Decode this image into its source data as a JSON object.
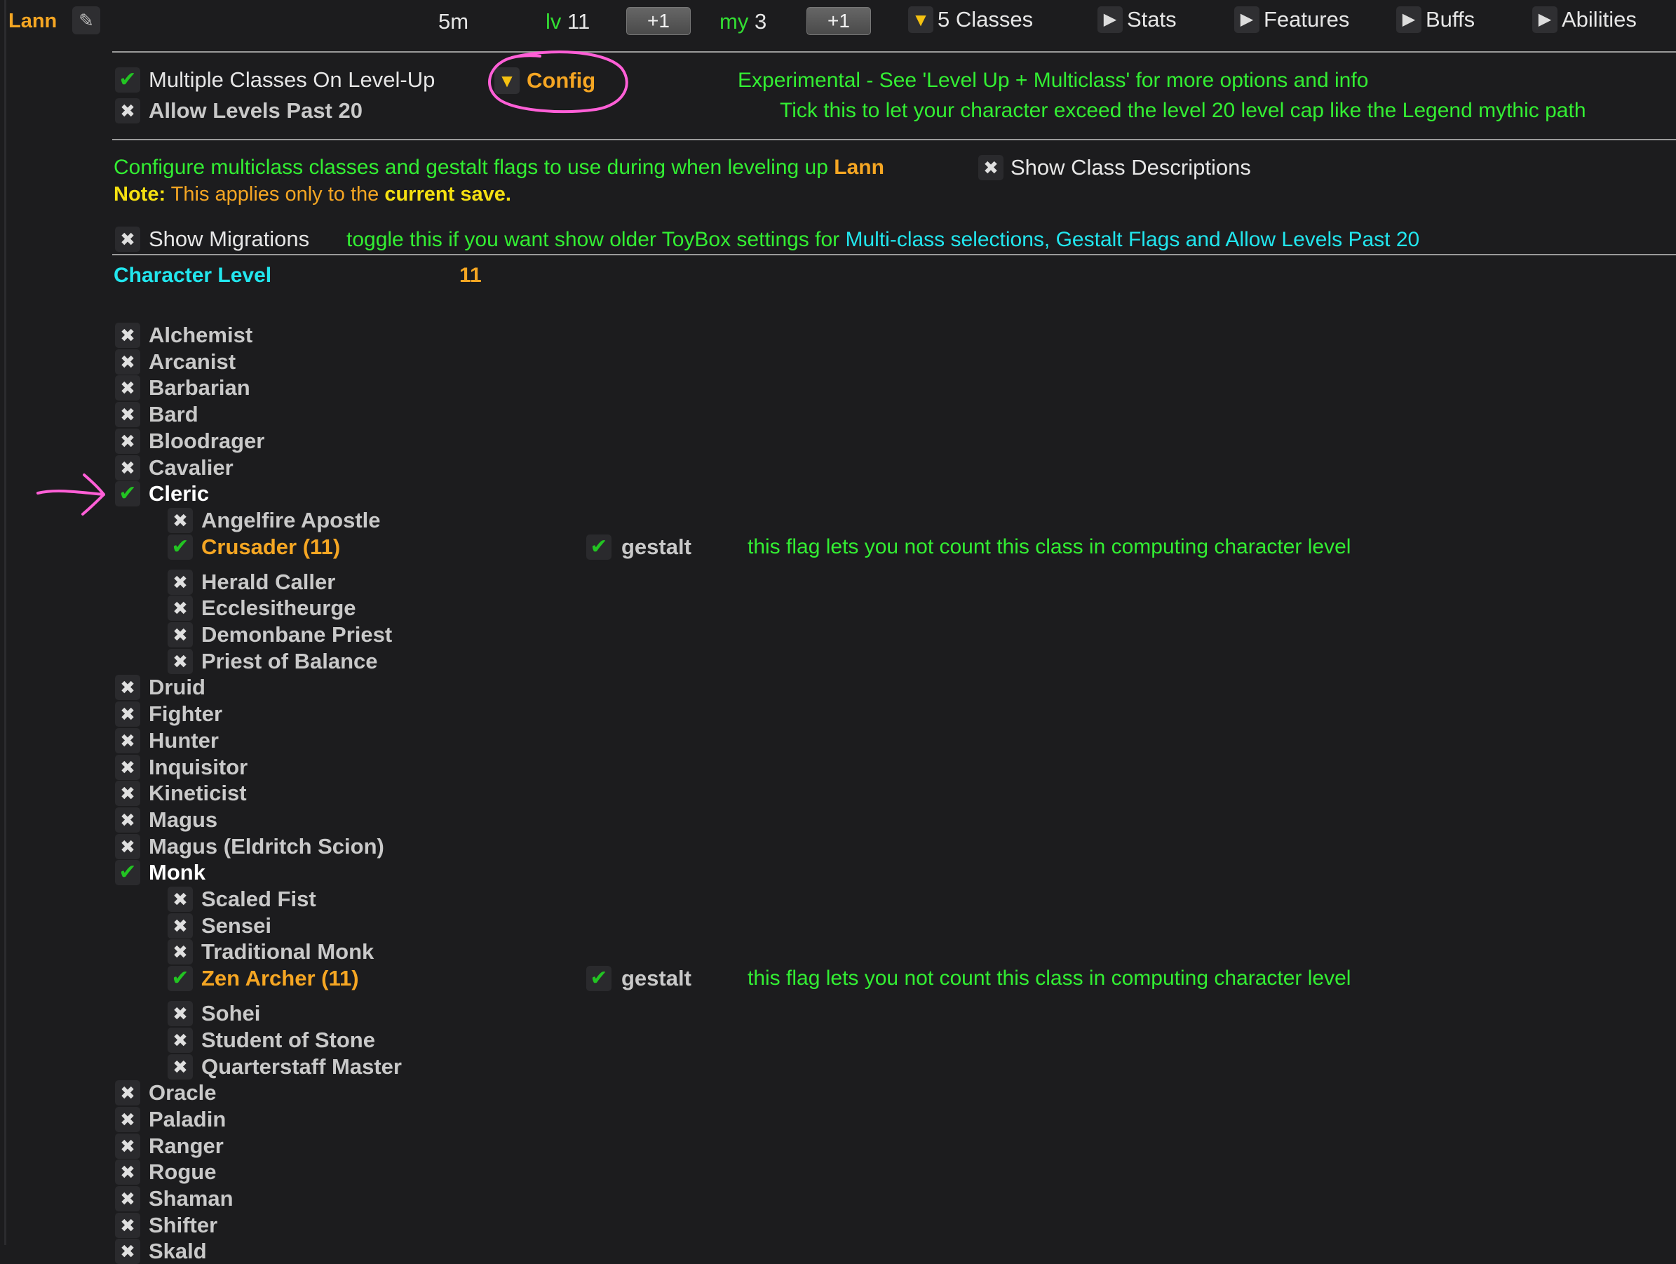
{
  "header": {
    "character_name": "Lann",
    "edit_icon": "pencil-icon",
    "time": "5m",
    "level_label": "lv",
    "level_value": "11",
    "level_plus": "+1",
    "mythic_label": "my",
    "mythic_value": "3",
    "mythic_plus": "+1",
    "nav": [
      {
        "label": "5 Classes",
        "expanded": true
      },
      {
        "label": "Stats",
        "expanded": false
      },
      {
        "label": "Features",
        "expanded": false
      },
      {
        "label": "Buffs",
        "expanded": false
      },
      {
        "label": "Abilities",
        "expanded": false
      }
    ]
  },
  "options": {
    "multiclass_label": "Multiple Classes On Level-Up",
    "multiclass_checked": true,
    "config_label": "Config",
    "multiclass_hint": "Experimental - See 'Level Up + Multiclass' for more options and info",
    "past20_label": "Allow Levels Past 20",
    "past20_checked": false,
    "past20_hint": "Tick this to let your character exceed the level 20 level cap like the Legend mythic path"
  },
  "config": {
    "desc_prefix": "Configure multiclass classes and gestalt flags to use during when leveling up",
    "desc_name": "Lann",
    "show_desc_label": "Show Class Descriptions",
    "note_label": "Note:",
    "note_text": "This applies only to the",
    "note_emphasis": "current save.",
    "migrations_label": "Show Migrations",
    "migrations_hint_prefix": "toggle this if you want show older ToyBox settings for",
    "migrations_hint_link": "Multi-class selections, Gestalt Flags and Allow Levels Past 20",
    "char_level_label": "Character Level",
    "char_level_value": "11"
  },
  "gestalt": {
    "label": "gestalt",
    "hint": "this flag lets you not count this class in computing character level"
  },
  "classes": [
    {
      "name": "Alchemist",
      "checked": false
    },
    {
      "name": "Arcanist",
      "checked": false
    },
    {
      "name": "Barbarian",
      "checked": false
    },
    {
      "name": "Bard",
      "checked": false
    },
    {
      "name": "Bloodrager",
      "checked": false
    },
    {
      "name": "Cavalier",
      "checked": false
    },
    {
      "name": "Cleric",
      "checked": true
    },
    {
      "name": "Angelfire Apostle",
      "checked": false,
      "archetype": true
    },
    {
      "name": "Crusader (11)",
      "checked": true,
      "archetype": true,
      "gestalt": true
    },
    {
      "name": "Herald Caller",
      "checked": false,
      "archetype": true
    },
    {
      "name": "Ecclesitheurge",
      "checked": false,
      "archetype": true
    },
    {
      "name": "Demonbane Priest",
      "checked": false,
      "archetype": true
    },
    {
      "name": "Priest of Balance",
      "checked": false,
      "archetype": true
    },
    {
      "name": "Druid",
      "checked": false
    },
    {
      "name": "Fighter",
      "checked": false
    },
    {
      "name": "Hunter",
      "checked": false
    },
    {
      "name": "Inquisitor",
      "checked": false
    },
    {
      "name": "Kineticist",
      "checked": false
    },
    {
      "name": "Magus",
      "checked": false
    },
    {
      "name": "Magus (Eldritch Scion)",
      "checked": false
    },
    {
      "name": "Monk",
      "checked": true
    },
    {
      "name": "Scaled Fist",
      "checked": false,
      "archetype": true
    },
    {
      "name": "Sensei",
      "checked": false,
      "archetype": true
    },
    {
      "name": "Traditional Monk",
      "checked": false,
      "archetype": true
    },
    {
      "name": "Zen Archer (11)",
      "checked": true,
      "archetype": true,
      "gestalt": true
    },
    {
      "name": "Sohei",
      "checked": false,
      "archetype": true
    },
    {
      "name": "Student of Stone",
      "checked": false,
      "archetype": true
    },
    {
      "name": "Quarterstaff Master",
      "checked": false,
      "archetype": true
    },
    {
      "name": "Oracle",
      "checked": false
    },
    {
      "name": "Paladin",
      "checked": false
    },
    {
      "name": "Ranger",
      "checked": false
    },
    {
      "name": "Rogue",
      "checked": false
    },
    {
      "name": "Shaman",
      "checked": false
    },
    {
      "name": "Shifter",
      "checked": false
    },
    {
      "name": "Skald",
      "checked": false
    }
  ],
  "colors": {
    "name_orange": "#f5a623",
    "hint_green": "#33ee33",
    "link_cyan": "#22e6ee",
    "annotation_pink": "#ff5fd7"
  }
}
